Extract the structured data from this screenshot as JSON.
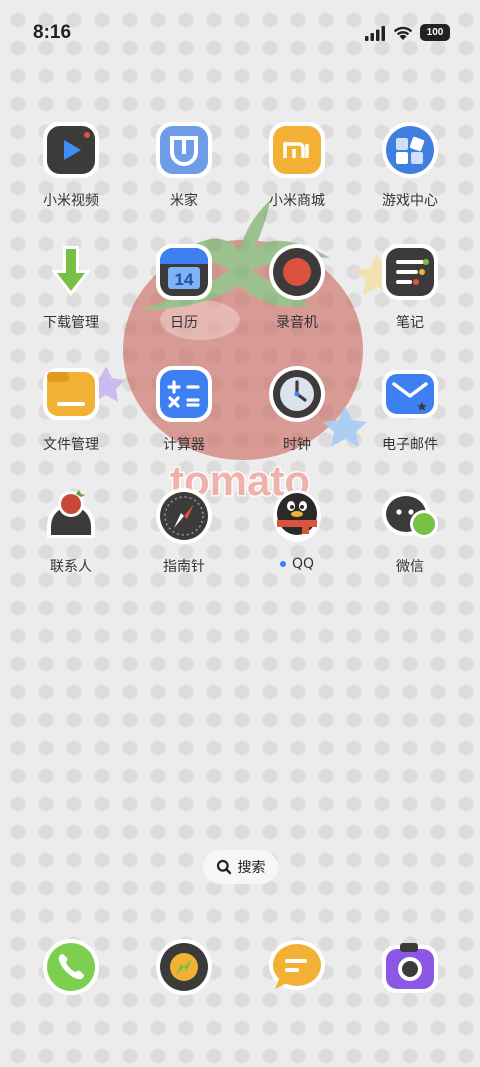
{
  "status_bar": {
    "time": "8:16",
    "battery": "100"
  },
  "apps": [
    {
      "label": "小米视频",
      "icon": "mi-video-icon"
    },
    {
      "label": "米家",
      "icon": "mijia-icon"
    },
    {
      "label": "小米商城",
      "icon": "mi-store-icon"
    },
    {
      "label": "游戏中心",
      "icon": "game-center-icon"
    },
    {
      "label": "下载管理",
      "icon": "download-icon"
    },
    {
      "label": "日历",
      "icon": "calendar-icon",
      "badge": "14"
    },
    {
      "label": "录音机",
      "icon": "recorder-icon"
    },
    {
      "label": "笔记",
      "icon": "notes-icon"
    },
    {
      "label": "文件管理",
      "icon": "folder-icon"
    },
    {
      "label": "计算器",
      "icon": "calculator-icon"
    },
    {
      "label": "时钟",
      "icon": "clock-icon"
    },
    {
      "label": "电子邮件",
      "icon": "mail-icon"
    },
    {
      "label": "联系人",
      "icon": "contacts-icon"
    },
    {
      "label": "指南针",
      "icon": "compass-icon"
    },
    {
      "label": "QQ",
      "icon": "qq-icon",
      "new_dot": true
    },
    {
      "label": "微信",
      "icon": "wechat-icon"
    }
  ],
  "search": {
    "label": "搜索"
  },
  "wallpaper": {
    "text": "tomato"
  },
  "dock": [
    {
      "icon": "phone-icon"
    },
    {
      "icon": "browser-icon"
    },
    {
      "icon": "messages-icon"
    },
    {
      "icon": "camera-icon"
    }
  ],
  "colors": {
    "accent": "#3e7ff1",
    "tomato": "#c24a3c",
    "stem": "#4f9b3a",
    "dark_tile": "#3d3b3a"
  }
}
